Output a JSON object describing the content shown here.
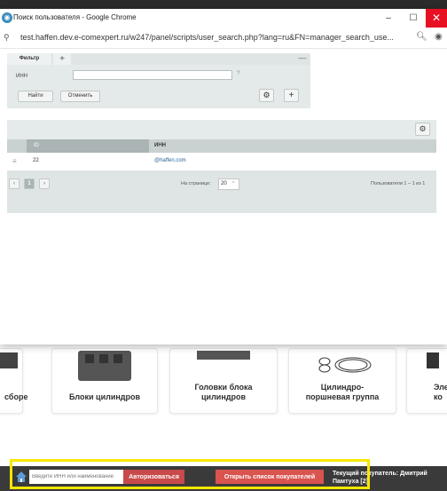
{
  "window": {
    "title": "Поиск пользователя - Google Chrome",
    "minimize_icon": "–",
    "maximize_icon": "☐",
    "close_icon": "✕",
    "url": "test.haffen.dev.e-comexpert.ru/w247/panel/scripts/user_search.php?lang=ru&FN=manager_search_use..."
  },
  "filter": {
    "tab_label": "Фильтр",
    "add_tab": "+",
    "collapse": "—",
    "inn_label": "ИНН",
    "inn_value": "",
    "help": "?",
    "find_label": "Найти",
    "cancel_label": "Отменить",
    "gear_icon": "⚙",
    "plus_icon": "+"
  },
  "grid": {
    "gear_icon": "⚙",
    "columns": [
      "ID",
      "ИНН"
    ],
    "sort_indicator": "▲",
    "rows": [
      {
        "id": "22",
        "inn": "@haffen.com"
      }
    ],
    "pager": {
      "prev": "‹",
      "current": "1",
      "next": "›",
      "per_page_label": "На странице:",
      "per_page_value": "20",
      "info": "Пользователи 1 – 1 из 1"
    }
  },
  "background": {
    "cards": [
      {
        "label": "сборе"
      },
      {
        "label": "Блоки цилиндров"
      },
      {
        "label": "Головки блока цилиндров"
      },
      {
        "label": "Цилиндро-поршневая группа"
      },
      {
        "label": "Эле ко"
      }
    ]
  },
  "toolbar": {
    "inn_placeholder": "Введите ИНН или наименование",
    "auth_label": "Авторизоваться",
    "open_list_label": "Открыть список покупателей",
    "current_buyer": "Текущий покупатель: Дмитрий Памтуха [2]"
  },
  "colors": {
    "highlight": "#f7e700",
    "close_button": "#e81123",
    "danger_button": "#d9534f",
    "link": "#2a6496"
  }
}
